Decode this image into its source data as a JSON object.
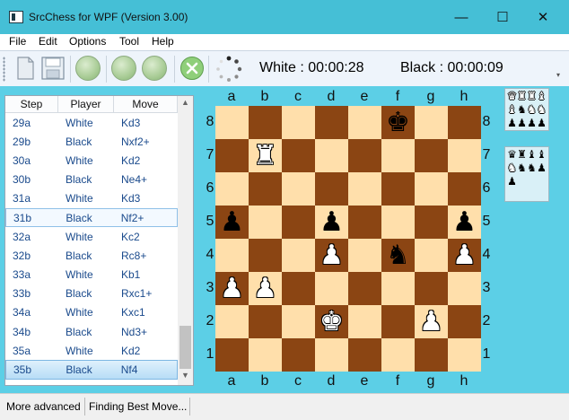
{
  "window": {
    "title": "SrcChess for WPF (Version 3.00)",
    "minimize_glyph": "—",
    "maximize_glyph": "☐",
    "close_glyph": "✕"
  },
  "menu": [
    "File",
    "Edit",
    "Options",
    "Tool",
    "Help"
  ],
  "toolbar": {
    "icons": [
      "new-game-icon",
      "save-icon",
      "undo-icon",
      "redo-icon",
      "play-icon",
      "cancel-icon",
      "thinking-spinner-icon"
    ],
    "white_clock": "White : 00:00:28",
    "black_clock": "Black : 00:00:09",
    "overflow_glyph": "▾"
  },
  "moves": {
    "headers": [
      "Step",
      "Player",
      "Move"
    ],
    "rows": [
      {
        "step": "29a",
        "player": "White",
        "move": "Kd3"
      },
      {
        "step": "29b",
        "player": "Black",
        "move": "Nxf2+"
      },
      {
        "step": "30a",
        "player": "White",
        "move": "Kd2"
      },
      {
        "step": "30b",
        "player": "Black",
        "move": "Ne4+"
      },
      {
        "step": "31a",
        "player": "White",
        "move": "Kd3"
      },
      {
        "step": "31b",
        "player": "Black",
        "move": "Nf2+"
      },
      {
        "step": "32a",
        "player": "White",
        "move": "Kc2"
      },
      {
        "step": "32b",
        "player": "Black",
        "move": "Rc8+"
      },
      {
        "step": "33a",
        "player": "White",
        "move": "Kb1"
      },
      {
        "step": "33b",
        "player": "Black",
        "move": "Rxc1+"
      },
      {
        "step": "34a",
        "player": "White",
        "move": "Kxc1"
      },
      {
        "step": "34b",
        "player": "Black",
        "move": "Nd3+"
      },
      {
        "step": "35a",
        "player": "White",
        "move": "Kd2"
      },
      {
        "step": "35b",
        "player": "Black",
        "move": "Nf4"
      }
    ],
    "highlighted_step": "31b",
    "selected_step": "35b",
    "scroll_up_glyph": "▲",
    "scroll_down_glyph": "▼"
  },
  "board": {
    "files": [
      "a",
      "b",
      "c",
      "d",
      "e",
      "f",
      "g",
      "h"
    ],
    "ranks": [
      "8",
      "7",
      "6",
      "5",
      "4",
      "3",
      "2",
      "1"
    ],
    "colors": {
      "light": "#ffdfab",
      "dark": "#8b4513"
    },
    "rows": [
      [
        "",
        "",
        "",
        "",
        "",
        "bK",
        "",
        ""
      ],
      [
        "",
        "wR",
        "",
        "",
        "",
        "",
        "",
        ""
      ],
      [
        "",
        "",
        "",
        "",
        "",
        "",
        "",
        ""
      ],
      [
        "bP",
        "",
        "",
        "bP",
        "",
        "",
        "",
        "bP"
      ],
      [
        "",
        "",
        "",
        "wP",
        "",
        "bN",
        "",
        "wP"
      ],
      [
        "wP",
        "wP",
        "",
        "",
        "",
        "",
        "",
        ""
      ],
      [
        "",
        "",
        "",
        "wK",
        "",
        "",
        "wP",
        ""
      ],
      [
        "",
        "",
        "",
        "",
        "",
        "",
        "",
        ""
      ]
    ]
  },
  "captured": {
    "top": [
      [
        "wQ",
        "wR",
        "wR",
        "wB"
      ],
      [
        "wB",
        "bN",
        "wN",
        "wN"
      ],
      [
        "bP",
        "bP",
        "bP",
        "bP"
      ]
    ],
    "bottom": [
      [
        "bQ",
        "bR",
        "bB",
        "bB"
      ],
      [
        "wN",
        "bN",
        "bN",
        "bP"
      ],
      [
        "bP",
        "",
        "",
        ""
      ]
    ]
  },
  "status": {
    "level": "More advanced",
    "message": "Finding Best Move..."
  }
}
